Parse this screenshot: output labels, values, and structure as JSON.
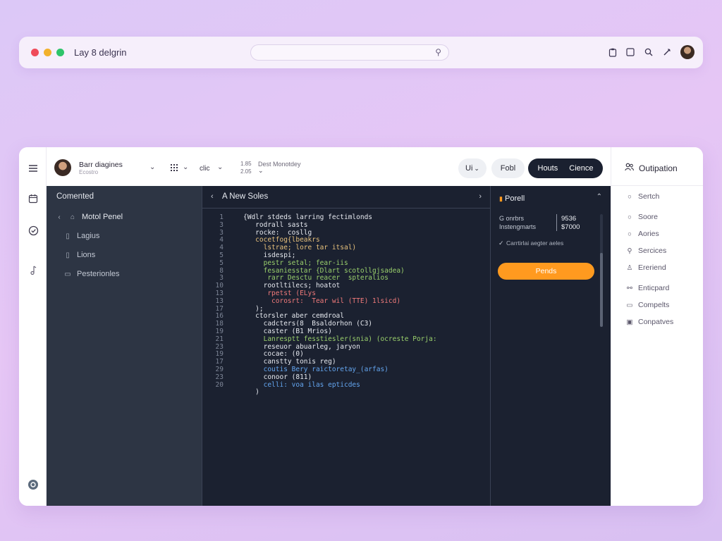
{
  "topbar": {
    "title": "Lay 8 delgrin",
    "icons": [
      "clipboard-icon",
      "square-icon",
      "search-icon",
      "pen-icon"
    ]
  },
  "header": {
    "user_name": "Barr diagines",
    "user_sub": "Ecostro",
    "grid_label": "",
    "view_label": "clic",
    "stat_top": "1.85",
    "stat_bottom": "2.05",
    "date_label": "Dest Monotdey",
    "pill_small": "Ui",
    "pill_fold": "Fobl",
    "pill_hours": "Houts",
    "pill_cience": "Cience"
  },
  "sidebar": {
    "title": "Comented",
    "root": "Motol Penel",
    "items": [
      {
        "label": "Lagius",
        "icon": "file-icon"
      },
      {
        "label": "Lions",
        "icon": "file-icon"
      },
      {
        "label": "Pesterionles",
        "icon": "folder-icon"
      }
    ]
  },
  "editor": {
    "tab_title": "A New Soles",
    "lines": [
      {
        "n": "1",
        "t": "{Wdlr stdeds larring fectimlonds"
      },
      {
        "n": "3",
        "t": "   rodrall sasts"
      },
      {
        "n": "3",
        "t": "   rocke:  cosllg"
      },
      {
        "n": "4",
        "t": "   cocetfog{lbeakrs"
      },
      {
        "n": "4",
        "t": "     lstrae; lore tar itsal)"
      },
      {
        "n": "5",
        "t": "     isdespi;"
      },
      {
        "n": "5",
        "t": "     pestr setal; fear-iis"
      },
      {
        "n": "8",
        "t": "     fesaniesstar {Dlart scotollgjsadea)"
      },
      {
        "n": "3",
        "t": "      rarr Desctu reacer  spteralios"
      },
      {
        "n": "10",
        "t": "     rootltilecs; hoatot"
      },
      {
        "n": "13",
        "t": "      rpetst (ELys"
      },
      {
        "n": "13",
        "t": "       corosrt:  Tear wil (TTE) 1lsicd)"
      },
      {
        "n": "17",
        "t": "   );"
      },
      {
        "n": "16",
        "t": "   ctorsler aber cemdroal"
      },
      {
        "n": "18",
        "t": "     cadcters(8  Bsaldorhon (C3)"
      },
      {
        "n": "19",
        "t": "     caster (B1 Mrios)"
      },
      {
        "n": "21",
        "t": "     Lanresptt fesstiesler(snia) (ocreste Porja:"
      },
      {
        "n": "23",
        "t": "     reseuor abuarleg, jaryon"
      },
      {
        "n": "19",
        "t": "     cocae: (0)"
      },
      {
        "n": "17",
        "t": "     canstty tonis reg)"
      },
      {
        "n": "29",
        "t": "     coutis Bery raictoretay_(arfas)"
      },
      {
        "n": "23",
        "t": "     conoor (811)"
      },
      {
        "n": "20",
        "t": "     celli: voa ilas epticdes"
      },
      {
        "n": "",
        "t": "   )"
      }
    ]
  },
  "panel": {
    "title": "Porell",
    "stat1_label": "G onrbrs",
    "stat1_value": "9536",
    "stat2_label": "Instengmarts",
    "stat2_value": "$7000",
    "check_text": "Carrtirlai aegter aeles",
    "button_label": "Pends"
  },
  "rnav": {
    "title": "Outipation",
    "items": [
      {
        "label": "Sertch",
        "icon": "circle-icon"
      },
      {
        "label": "Soore",
        "icon": "circle-icon"
      },
      {
        "label": "Aories",
        "icon": "circle-icon"
      },
      {
        "label": "Sercices",
        "icon": "search-icon"
      },
      {
        "label": "Ereriend",
        "icon": "user-icon"
      },
      {
        "label": "Enticpard",
        "icon": "link-icon"
      },
      {
        "label": "Compelts",
        "icon": "chat-icon"
      },
      {
        "label": "Conpatves",
        "icon": "image-icon"
      }
    ]
  },
  "colors": {
    "accent": "#ff9a1f",
    "dark_bg": "#1b2130",
    "sidebar_bg": "#2d3544",
    "dot_red": "#ef4b5a",
    "dot_yellow": "#f2b12c",
    "dot_green": "#2ec46a"
  }
}
